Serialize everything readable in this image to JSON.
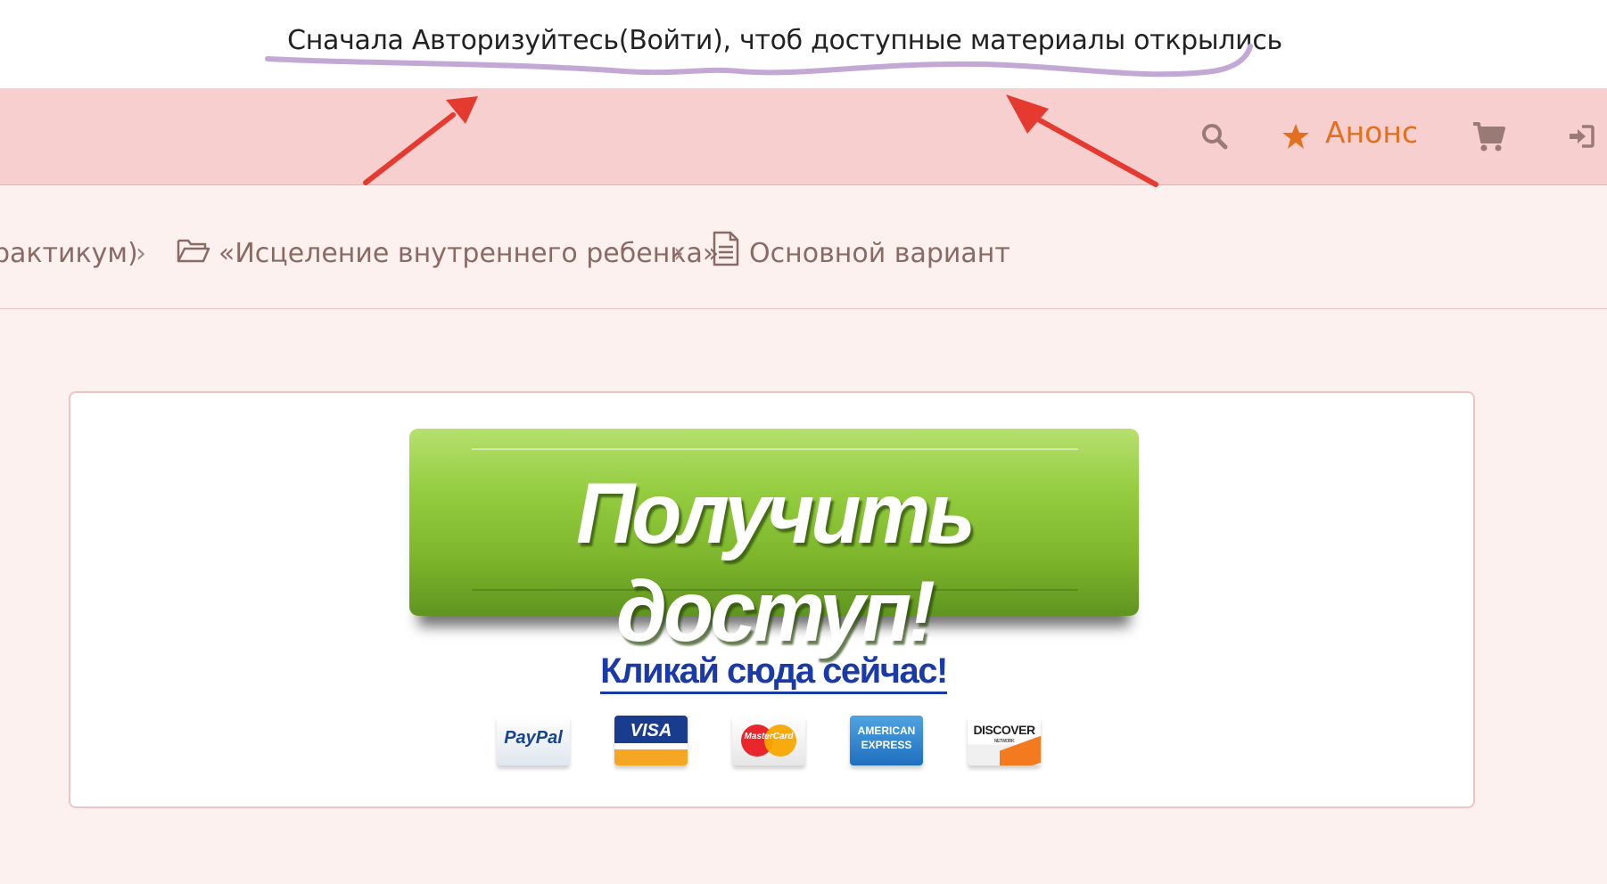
{
  "notice": {
    "text": "Сначала Авторизуйтесь(Войти), чтоб доступные материалы открылись",
    "underline_color": "#c3a8d6"
  },
  "navbar": {
    "background": "#f8cfcf",
    "anons_label": "Анонс",
    "anons_color": "#e3701f",
    "icons": [
      "search-icon",
      "star-icon",
      "cart-icon",
      "login-icon"
    ]
  },
  "breadcrumb": {
    "items": [
      {
        "label": "рактикум)"
      },
      {
        "label": "«Исцеление внутреннего ребенка»",
        "icon": "folder-open-icon"
      },
      {
        "label": "Основной вариант",
        "icon": "document-icon"
      }
    ],
    "separator": "›"
  },
  "card": {
    "cta_label": "Получить доступ!",
    "cta_color": "#7cb52b",
    "link_label": "Кликай сюда сейчас!",
    "link_color": "#1a3aa8",
    "payment_methods": [
      {
        "name": "paypal-logo",
        "text": "PayPal"
      },
      {
        "name": "visa-logo",
        "text": "VISA"
      },
      {
        "name": "mastercard-logo",
        "text": "MasterCard"
      },
      {
        "name": "amex-logo",
        "text_line1": "AMERICAN",
        "text_line2": "EXPRESS"
      },
      {
        "name": "discover-logo",
        "text": "DISCOVER",
        "sub": "NETWORK"
      }
    ]
  },
  "annotation_arrows_color": "#e53a2f"
}
